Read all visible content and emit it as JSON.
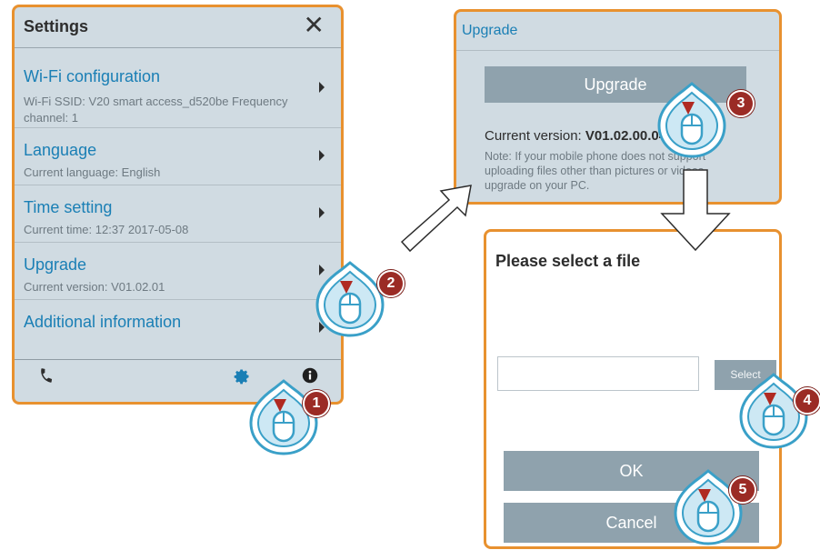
{
  "settings": {
    "title": "Settings",
    "close_icon": "close-icon",
    "items": [
      {
        "label": "Wi-Fi configuration",
        "sub1": "Wi-Fi SSID: V20 smart access_d520be   Frequency",
        "sub2": "channel: 1"
      },
      {
        "label": "Language",
        "sub1": "Current language: English"
      },
      {
        "label": "Time setting",
        "sub1": "Current time: 12:37 2017-05-08"
      },
      {
        "label": "Upgrade",
        "sub1": "Current version: V01.02.01"
      },
      {
        "label": "Additional information"
      }
    ],
    "footer_icons": [
      "phone-icon",
      "gear-icon",
      "info-icon"
    ]
  },
  "upgrade": {
    "title": "Upgrade",
    "button_label": "Upgrade",
    "version_prefix": "Current version: ",
    "version_value": "V01.02.00.04",
    "note": "Note: If your mobile phone does not support uploading files other than pictures or videos, upgrade on your PC."
  },
  "file_dialog": {
    "title": "Please select a file",
    "file_value": "",
    "select_label": "Select",
    "ok_label": "OK",
    "cancel_label": "Cancel"
  },
  "steps": [
    "1",
    "2",
    "3",
    "4",
    "5"
  ],
  "colors": {
    "panel_border": "#e8912f",
    "panel_bg": "#d0dbe2",
    "link": "#1a7fb5",
    "button": "#8fa2ad",
    "step_badge": "#9b2b25",
    "cursor": "#3aa0c8"
  }
}
